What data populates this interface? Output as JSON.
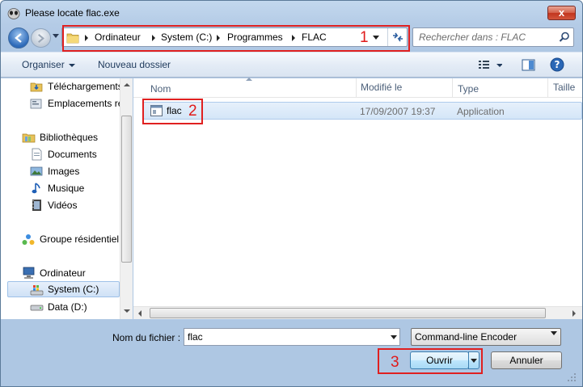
{
  "window": {
    "title": "Please locate flac.exe",
    "close_label": "x"
  },
  "address": {
    "crumbs": [
      "Ordinateur",
      "System (C:)",
      "Programmes",
      "FLAC"
    ]
  },
  "search": {
    "placeholder": "Rechercher dans : FLAC"
  },
  "toolbar": {
    "organize_label": "Organiser",
    "new_folder_label": "Nouveau dossier"
  },
  "sidebar": {
    "items": [
      {
        "label": "Téléchargements",
        "icon": "downloads-folder-icon"
      },
      {
        "label": "Emplacements ré",
        "icon": "recent-places-icon"
      },
      {
        "label": "Bibliothèques",
        "icon": "libraries-icon"
      },
      {
        "label": "Documents",
        "icon": "documents-icon"
      },
      {
        "label": "Images",
        "icon": "images-icon"
      },
      {
        "label": "Musique",
        "icon": "music-icon"
      },
      {
        "label": "Vidéos",
        "icon": "videos-icon"
      },
      {
        "label": "Groupe résidentiel",
        "icon": "homegroup-icon"
      },
      {
        "label": "Ordinateur",
        "icon": "computer-icon"
      },
      {
        "label": "System (C:)",
        "icon": "system-drive-icon"
      },
      {
        "label": "Data (D:)",
        "icon": "data-drive-icon"
      }
    ]
  },
  "columns": {
    "name": "Nom",
    "modified": "Modifié le",
    "type": "Type",
    "size": "Taille"
  },
  "files": [
    {
      "name": "flac",
      "modified": "17/09/2007 19:37",
      "type": "Application",
      "icon": "application-icon"
    }
  ],
  "footer": {
    "filename_label": "Nom du fichier :",
    "filename_value": "flac",
    "filter_value": "Command-line Encoder",
    "open_label": "Ouvrir",
    "cancel_label": "Annuler"
  },
  "annotations": [
    "1",
    "2",
    "3"
  ],
  "colors": {
    "callout": "#e02020",
    "selection": "#d4e6f8",
    "toolbar_text": "#1e395b"
  }
}
